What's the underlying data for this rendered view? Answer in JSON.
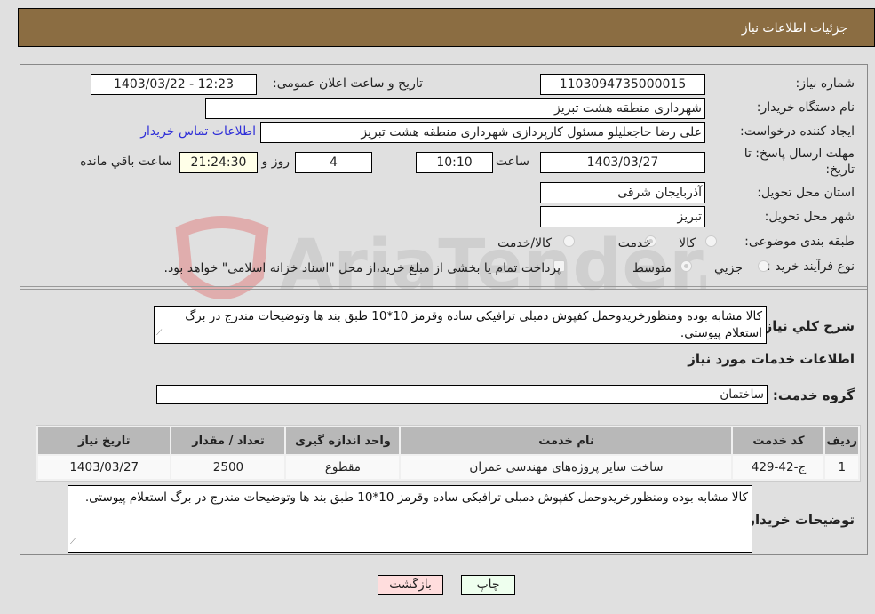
{
  "header": {
    "title": "جزئیات اطلاعات نیاز"
  },
  "form": {
    "need_number": {
      "label": "شماره نیاز:",
      "value": "1103094735000015"
    },
    "announce_datetime": {
      "label": "تاریخ و ساعت اعلان عمومی:",
      "value": "1403/03/22 - 12:23"
    },
    "buyer_org": {
      "label": "نام دستگاه خریدار:",
      "value": "شهرداری منطقه هشت تبریز"
    },
    "requester": {
      "label": "ایجاد کننده درخواست:",
      "value": "علی رضا حاجعلیلو مسئول کارپردازی شهرداری منطقه هشت تبریز"
    },
    "buyer_contact_link": "اطلاعات تماس خریدار",
    "deadline": {
      "label_line1": "مهلت ارسال پاسخ: تا",
      "label_line2": "تاریخ:",
      "date": "1403/03/27",
      "time_label": "ساعت",
      "time": "10:10",
      "days": "4",
      "days_label": "روز و",
      "remaining": "21:24:30",
      "remaining_label": "ساعت باقي مانده"
    },
    "province": {
      "label": "استان محل تحویل:",
      "value": "آذربایجان شرقی"
    },
    "city": {
      "label": "شهر محل تحویل:",
      "value": "تبریز"
    },
    "category": {
      "label": "طبقه بندی موضوعی:",
      "options": [
        "کالا",
        "خدمت",
        "کالا/خدمت"
      ],
      "selected": "خدمت"
    },
    "purchase_type": {
      "label": "نوع فرآیند خرید :",
      "options": [
        "جزيي",
        "متوسط"
      ],
      "selected": "متوسط",
      "treasury_note": "پرداخت تمام یا بخشی از مبلغ خرید،از محل \"اسناد خزانه اسلامی\" خواهد بود."
    },
    "general_description": {
      "label": "شرح کلي نياز:",
      "value": "کالا مشابه بوده ومنظورخریدوحمل کفپوش دمبلی ترافیکی ساده وقرمز 10*10 طبق بند ها وتوضیحات مندرج در برگ استعلام پیوستی."
    }
  },
  "services": {
    "section_title": "اطلاعات خدمات مورد نیاز",
    "group_label": "گروه خدمت:",
    "group_value": "ساختمان",
    "columns": [
      "ردیف",
      "کد خدمت",
      "نام خدمت",
      "واحد اندازه گیری",
      "تعداد / مقدار",
      "تاریخ نیاز"
    ],
    "rows": [
      [
        "1",
        "ج-42-429",
        "ساخت سایر پروژه‌های مهندسی عمران",
        "مقطوع",
        "2500",
        "1403/03/27"
      ]
    ]
  },
  "buyer_notes": {
    "label": "توضیحات خریدار:",
    "value": "کالا مشابه بوده ومنظورخریدوحمل کفپوش دمبلی ترافیکی ساده وقرمز 10*10 طبق بند ها وتوضیحات مندرج در برگ استعلام پیوستی."
  },
  "buttons": {
    "print": "چاپ",
    "back": "بازگشت"
  },
  "watermark": {
    "text": "AriaTender.neT"
  },
  "colors": {
    "header_bg": "#8b6d42",
    "print_bg": "#eeffee",
    "back_bg": "#ffdddd",
    "link": "#2f2fd8"
  }
}
